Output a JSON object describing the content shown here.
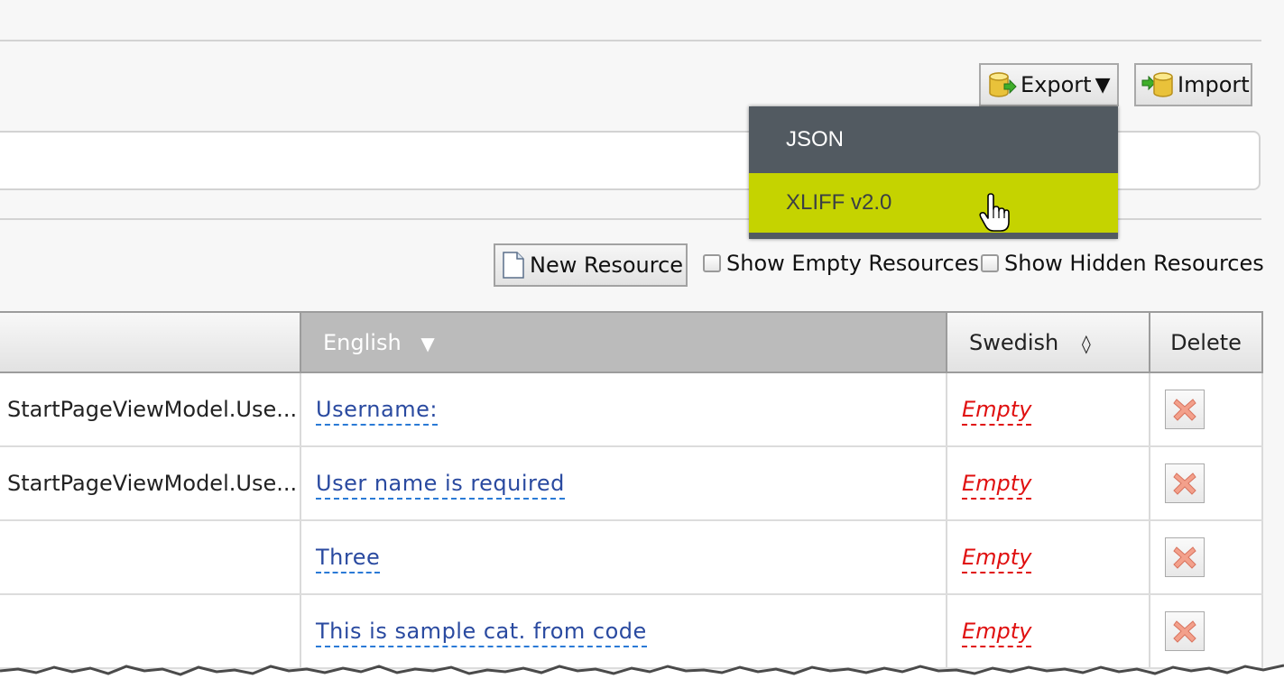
{
  "toolbar": {
    "export_label": "Export",
    "export_caret": "▼",
    "import_label": "Import"
  },
  "export_menu": {
    "items": [
      {
        "label": "JSON",
        "highlighted": false
      },
      {
        "label": "XLIFF v2.0",
        "highlighted": true
      }
    ]
  },
  "actions": {
    "new_resource_label": "New Resource",
    "show_empty_label": "Show Empty Resources",
    "show_empty_checked": false,
    "show_hidden_label": "Show Hidden Resources",
    "show_hidden_checked": false
  },
  "table": {
    "columns": [
      {
        "label": "",
        "sort": ""
      },
      {
        "label": "English",
        "sort": "▼"
      },
      {
        "label": "Swedish",
        "sort": "◊"
      },
      {
        "label": "Delete",
        "sort": ""
      }
    ],
    "rows": [
      {
        "key": "StartPageViewModel.Use...",
        "english": "Username:",
        "swedish": "Empty"
      },
      {
        "key": "StartPageViewModel.Use...",
        "english": "User name is required",
        "swedish": "Empty"
      },
      {
        "key": "",
        "english": "Three",
        "swedish": "Empty"
      },
      {
        "key": "",
        "english": "This is sample cat. from code",
        "swedish": "Empty"
      }
    ]
  },
  "colors": {
    "menu_background": "#525a61",
    "menu_highlight": "#c5d300",
    "sorted_header": "#bbbbbb",
    "link_text": "#2a4aa0",
    "empty_text": "#e01010"
  },
  "icons": {
    "export": "database-export-icon",
    "import": "database-import-icon",
    "new_resource": "new-document-icon",
    "delete": "delete-x-icon",
    "cursor": "hand-pointer-icon"
  }
}
